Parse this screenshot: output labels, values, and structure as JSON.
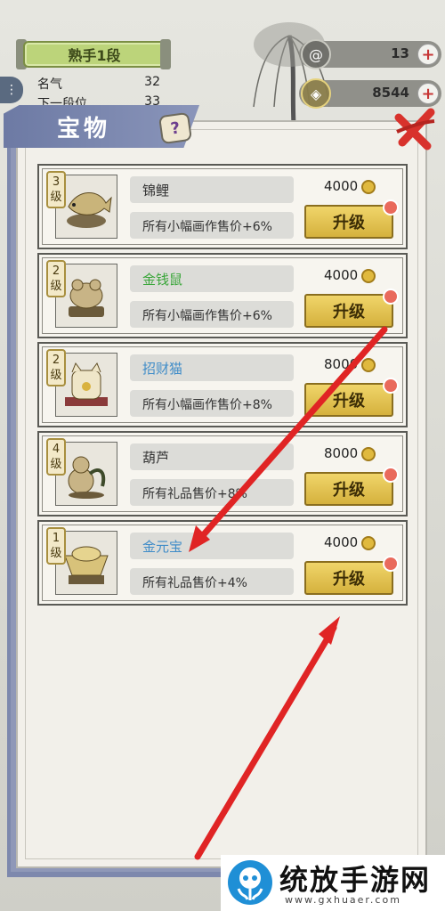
{
  "hud": {
    "rank_title": "熟手1段",
    "rows": [
      {
        "label": "名气",
        "value": "32"
      },
      {
        "label": "下一段位",
        "value": "33"
      }
    ],
    "resource_top": {
      "value": "13",
      "plus": "+"
    },
    "resource_gold": {
      "value": "8544",
      "plus": "+"
    }
  },
  "dialog": {
    "title": "宝物",
    "help_label": "?"
  },
  "items": [
    {
      "level_num": "3",
      "level_unit": "级",
      "name": "锦鲤",
      "desc": "所有小幅画作售价+6%",
      "price": "4000",
      "button": "升级",
      "name_color": "default"
    },
    {
      "level_num": "2",
      "level_unit": "级",
      "name": "金钱鼠",
      "desc": "所有小幅画作售价+6%",
      "price": "4000",
      "button": "升级",
      "name_color": "green"
    },
    {
      "level_num": "2",
      "level_unit": "级",
      "name": "招财猫",
      "desc": "所有小幅画作售价+8%",
      "price": "8000",
      "button": "升级",
      "name_color": "blue"
    },
    {
      "level_num": "4",
      "level_unit": "级",
      "name": "葫芦",
      "desc": "所有礼品售价+8%",
      "price": "8000",
      "button": "升级",
      "name_color": "default"
    },
    {
      "level_num": "1",
      "level_unit": "级",
      "name": "金元宝",
      "desc": "所有礼品售价+4%",
      "price": "4000",
      "button": "升级",
      "name_color": "blue"
    }
  ],
  "colors": {
    "accent_gold": "#e0b93e",
    "red_annotation": "#e02424",
    "tab_blue": "#6d7aa4"
  },
  "watermark": {
    "title": "统放手游网",
    "url": "www.gxhuaer.com"
  }
}
